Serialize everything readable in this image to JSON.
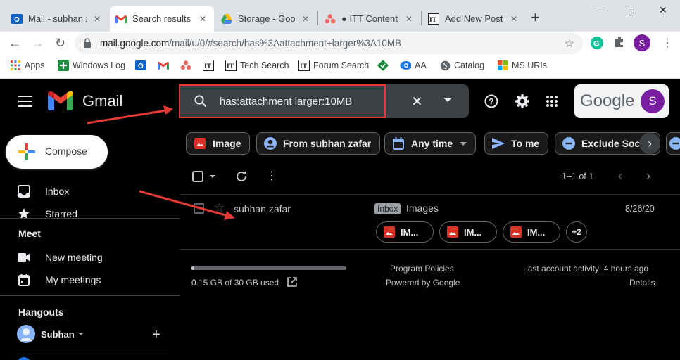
{
  "browser": {
    "tabs": [
      {
        "title": "Mail - subhan z",
        "active": false
      },
      {
        "title": "Search results -",
        "active": true
      },
      {
        "title": "Storage - Goog",
        "active": false
      },
      {
        "title": "● ITT Content -",
        "active": false
      },
      {
        "title": "Add New Post",
        "active": false
      }
    ],
    "url_host": "mail.google.com",
    "url_path": "/mail/u/0/#search/has%3Aattachment+larger%3A10MB",
    "profile_initial": "S",
    "bookmarks": [
      "Apps",
      "Windows Log",
      "Tech Search",
      "Forum Search",
      "AA",
      "Catalog",
      "MS URIs"
    ]
  },
  "gmail": {
    "app_name": "Gmail",
    "search_query": "has:attachment larger:10MB",
    "google_label": "Google",
    "avatar_initial": "S"
  },
  "sidebar": {
    "compose_label": "Compose",
    "items": [
      {
        "label": "Inbox",
        "icon": "inbox-icon"
      },
      {
        "label": "Starred",
        "icon": "star-icon"
      }
    ],
    "meet": {
      "title": "Meet",
      "items": [
        {
          "label": "New meeting",
          "icon": "video-icon"
        },
        {
          "label": "My meetings",
          "icon": "calendar-icon"
        }
      ]
    },
    "hangouts": {
      "title": "Hangouts",
      "user": "Subhan"
    }
  },
  "chips": [
    {
      "label": "Image",
      "icon": "image-icon"
    },
    {
      "label": "From subhan zafar",
      "icon": "person-icon"
    },
    {
      "label": "Any time",
      "icon": "calendar-icon"
    },
    {
      "label": "To me",
      "icon": "send-icon"
    },
    {
      "label": "Exclude Soci",
      "icon": "minus-circle-icon"
    }
  ],
  "list": {
    "pagination": "1–1 of 1"
  },
  "messages": [
    {
      "sender": "subhan zafar",
      "label": "Inbox",
      "subject": "Images",
      "date": "8/26/20",
      "attachments": [
        "IM...",
        "IM...",
        "IM..."
      ],
      "more_count": "+2"
    }
  ],
  "footer": {
    "storage_used": "0.15 GB of 30 GB used",
    "storage_fraction": 0.005,
    "program_policies": "Program Policies",
    "powered_by": "Powered by Google",
    "last_activity": "Last account activity: 4 hours ago",
    "details": "Details"
  },
  "colors": {
    "annotation_red": "#e53935",
    "accent_purple": "#7b1fa2",
    "attachment_red": "#d93025"
  }
}
